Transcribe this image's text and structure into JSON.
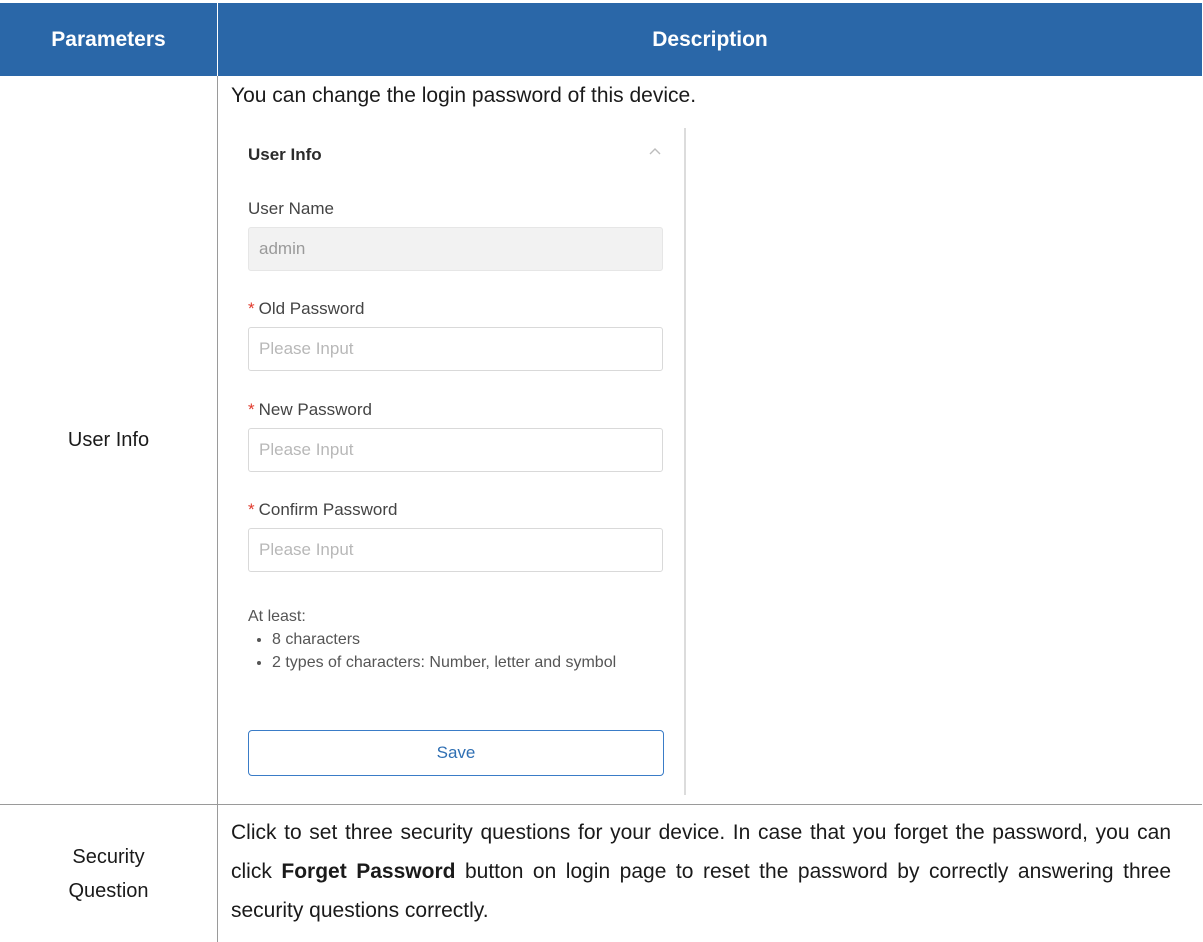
{
  "table": {
    "header": {
      "parameters": "Parameters",
      "description": "Description"
    },
    "rows": [
      {
        "label": "User Info",
        "intro": "You can change the login password of this device.",
        "panel": {
          "title": "User Info",
          "username_label": "User Name",
          "username_value": "admin",
          "old_password_label": "Old Password",
          "old_password_placeholder": "Please Input",
          "new_password_label": "New Password",
          "new_password_placeholder": "Please Input",
          "confirm_password_label": "Confirm Password",
          "confirm_password_placeholder": "Please Input",
          "required_mark": "*",
          "rules_title": "At least:",
          "rules": [
            "8 characters",
            "2 types of characters: Number, letter and symbol"
          ],
          "save_label": "Save"
        }
      },
      {
        "label_line1": "Security",
        "label_line2": "Question",
        "text_before": "Click to set three security questions for your device. In case that you forget the password, you can click ",
        "text_bold": "Forget Password",
        "text_after": " button on login page to reset the password by correctly answering three security questions correctly."
      }
    ]
  }
}
